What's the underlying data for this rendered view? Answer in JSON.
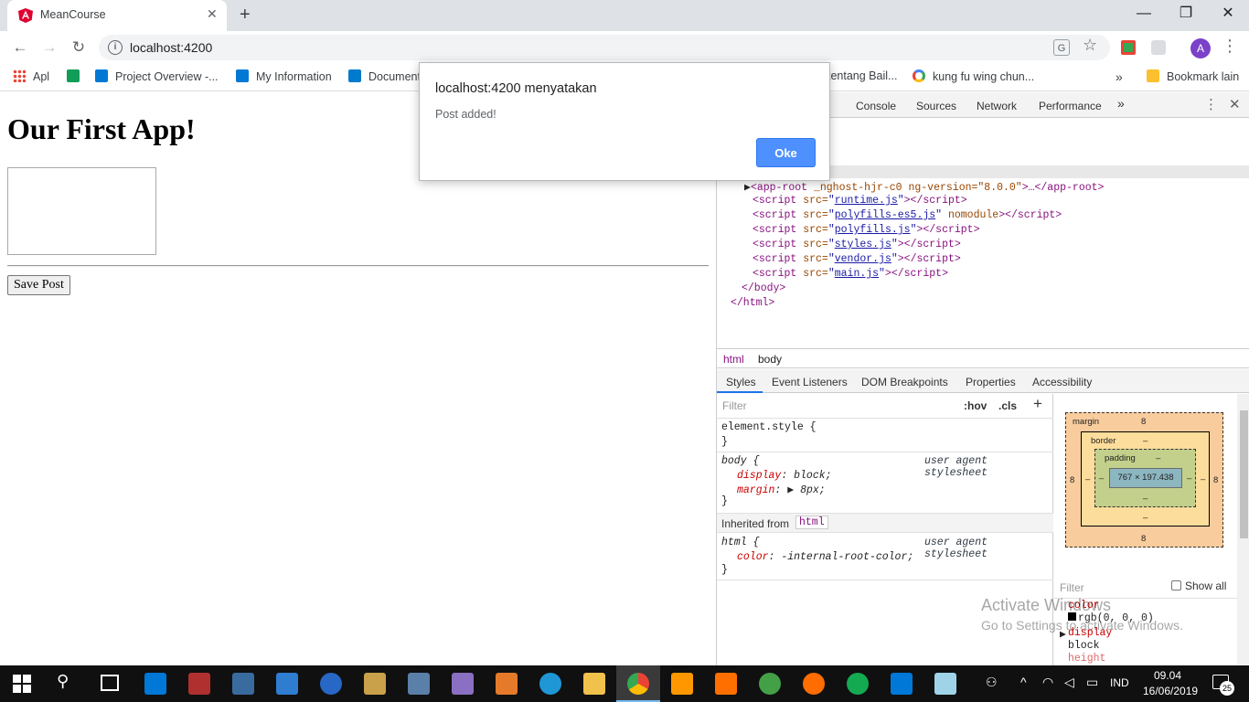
{
  "browser": {
    "tab_title": "MeanCourse",
    "url": "localhost:4200",
    "bookmarks": [
      {
        "label": "Apl",
        "icon": "apps-icon"
      },
      {
        "label": "",
        "icon": "sheets-icon"
      },
      {
        "label": "Project Overview -...",
        "icon": "azure-devops-icon"
      },
      {
        "label": "My Information",
        "icon": "azure-devops-icon"
      },
      {
        "label": "Document",
        "icon": "vscode-icon"
      },
      {
        "label": "tentang Bail...",
        "icon": "page-icon"
      },
      {
        "label": "kung fu wing chun...",
        "icon": "google-icon"
      },
      {
        "label": "Bookmark lain",
        "icon": "folder-icon"
      }
    ],
    "avatar_initial": "A",
    "accent": "#1a73e8"
  },
  "page": {
    "title": "Our First App!",
    "textarea_value": "",
    "save_button": "Save Post"
  },
  "dialog": {
    "title": "localhost:4200 menyatakan",
    "message": "Post added!",
    "ok_label": "Oke"
  },
  "devtools": {
    "tabs": [
      "s",
      "Console",
      "Sources",
      "Network",
      "Performance"
    ],
    "more": "»",
    "elements_lines": [
      {
        "tag": "app-root",
        "attrs": " _nghost-hjr-c0 ng-version=\"8.0.0\"",
        "tail": ">…</app-root>"
      },
      {
        "src": "runtime.js"
      },
      {
        "src": "polyfills-es5.js",
        "extra": " nomodule"
      },
      {
        "src": "polyfills.js"
      },
      {
        "src": "styles.js"
      },
      {
        "src": "vendor.js"
      },
      {
        "src": "main.js"
      }
    ],
    "closing_body": "</body>",
    "closing_html": "</html>",
    "breadcrumbs": [
      "html",
      "body"
    ],
    "style_tabs": [
      "Styles",
      "Event Listeners",
      "DOM Breakpoints",
      "Properties",
      "Accessibility"
    ],
    "filter_placeholder": "Filter",
    "hov": ":hov",
    "cls": ".cls",
    "rules": {
      "element_style": "element.style {",
      "close": "}",
      "body_selector": "body {",
      "body_source": "user agent stylesheet",
      "body_display_prop": "display",
      "body_display_val": "block;",
      "body_margin_prop": "margin",
      "body_margin_val": "8px;",
      "inherited_label": "Inherited from",
      "inherited_tag": "html",
      "html_selector": "html {",
      "html_source": "user agent stylesheet",
      "html_color_prop": "color",
      "html_color_val": "-internal-root-color;"
    },
    "box_model": {
      "margin_label": "margin",
      "margin_top": "8",
      "margin_bottom": "8",
      "margin_left": "8",
      "margin_right": "8",
      "border_label": "border",
      "border_top": "–",
      "border_bottom": "–",
      "border_left": "–",
      "border_right": "–",
      "padding_label": "padding",
      "padding_top": "–",
      "padding_bottom": "–",
      "padding_left": "–",
      "padding_right": "–",
      "content": "767 × 197.438"
    },
    "computed": {
      "filter_placeholder": "Filter",
      "show_all": "Show all",
      "color_prop": "color",
      "color_val": "rgb(0, 0, 0)",
      "display_prop": "display",
      "display_val": "block",
      "height_prop": "height"
    }
  },
  "watermark": {
    "line1": "Activate Windows",
    "line2": "Go to Settings to activate Windows."
  },
  "taskbar": {
    "language": "IND",
    "time": "09.04",
    "date": "16/06/2019",
    "notifications": "25"
  }
}
